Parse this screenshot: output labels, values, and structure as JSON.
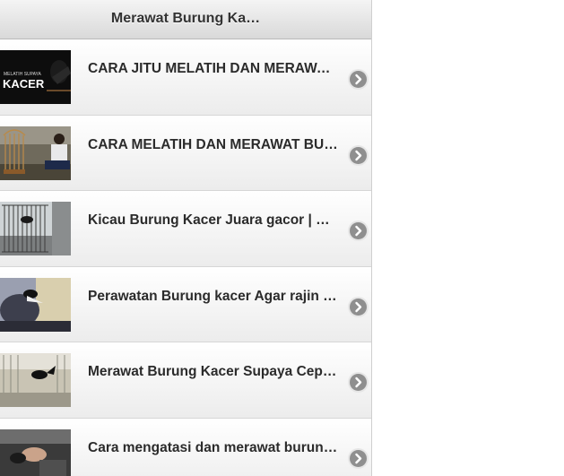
{
  "header": {
    "title": "Merawat Burung Ka…"
  },
  "items": [
    {
      "title": "CARA JITU MELATIH DAN MERAWAT BURUNG KACER",
      "thumb_text_top": "MELATIH SUPAYA",
      "thumb_text_main": "KACER"
    },
    {
      "title": "CARA MELATIH DAN MERAWAT BURUNG KACER"
    },
    {
      "title": "Kicau Burung Kacer Juara gacor | Cara Merawat Kacer"
    },
    {
      "title": "Perawatan Burung kacer Agar rajin Bunyi"
    },
    {
      "title": "Merawat Burung Kacer Supaya Cepat Gacor"
    },
    {
      "title": "Cara mengatasi dan merawat burung kacer"
    }
  ],
  "icons": {
    "item_arrow": "chevron-right-circle-icon"
  }
}
